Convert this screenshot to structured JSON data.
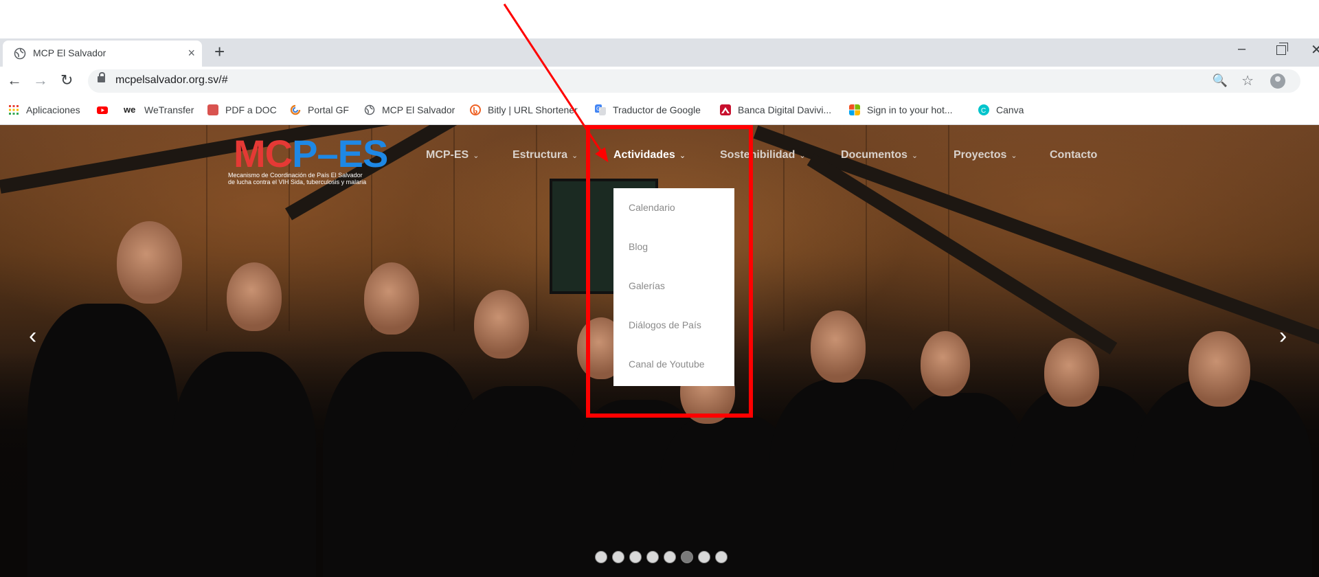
{
  "browser": {
    "tab": {
      "title": "MCP El Salvador",
      "close": "×"
    },
    "new_tab": "+",
    "window_controls": {
      "minimize": "–",
      "close": "✕"
    },
    "nav": {
      "back": "←",
      "forward": "→",
      "reload": "↻"
    },
    "url": "mcpelsalvador.org.sv/#",
    "icons": {
      "zoom": "🔍",
      "star": "☆"
    },
    "bookmarks": [
      {
        "label": "Aplicaciones",
        "icon": "apps-grid-icon",
        "color": "#e94235"
      },
      {
        "label": "",
        "icon": "youtube-icon",
        "color": "#ff0000"
      },
      {
        "label": "WeTransfer",
        "icon": "wetransfer-icon",
        "color": "#222222"
      },
      {
        "label": "PDF a DOC",
        "icon": "pdf-doc-icon",
        "color": "#d9534f"
      },
      {
        "label": "Portal GF",
        "icon": "portal-gf-icon",
        "color": "#e67e22"
      },
      {
        "label": "MCP El Salvador",
        "icon": "globe-icon",
        "color": "#5f6368"
      },
      {
        "label": "Bitly | URL Shortener",
        "icon": "bitly-icon",
        "color": "#ee6123"
      },
      {
        "label": "Traductor de Google",
        "icon": "google-translate-icon",
        "color": "#4285f4"
      },
      {
        "label": "Banca Digital Davivi...",
        "icon": "davivienda-icon",
        "color": "#c8102e"
      },
      {
        "label": "Sign in to your hot...",
        "icon": "microsoft-icon",
        "color": "#f25022"
      },
      {
        "label": "Canva",
        "icon": "canva-icon",
        "color": "#00c4cc"
      }
    ]
  },
  "site": {
    "logo": {
      "text_m": "M",
      "text_c": "C",
      "text_p": "P",
      "text_dash": "–",
      "text_es": "ES",
      "subtitle_line1": "Mecanismo de Coordinación de País El Salvador",
      "subtitle_line2": "de lucha contra el VIH Sida, tuberculosis y malaria",
      "colors": {
        "m": "#e53935",
        "c": "#e53935",
        "p": "#1e88e5",
        "dash": "#1e88e5",
        "es": "#1e88e5"
      }
    },
    "nav": [
      {
        "label": "MCP-ES",
        "chevron": "⌄"
      },
      {
        "label": "Estructura",
        "chevron": "⌄"
      },
      {
        "label": "Actividades",
        "chevron": "⌄"
      },
      {
        "label": "Sostenibilidad",
        "chevron": "⌄"
      },
      {
        "label": "Documentos",
        "chevron": "⌄"
      },
      {
        "label": "Proyectos",
        "chevron": "⌄"
      },
      {
        "label": "Contacto"
      }
    ],
    "dropdown": [
      "Calendario",
      "Blog",
      "Galerías",
      "Diálogos de País",
      "Canal de Youtube"
    ],
    "slider": {
      "prev": "‹",
      "next": "›",
      "dots": 8,
      "active_dot": 6
    },
    "annotation_color": "#ff0000"
  }
}
